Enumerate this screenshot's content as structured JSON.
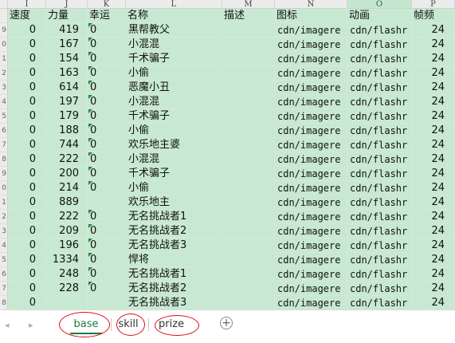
{
  "columns": [
    {
      "letter": "I",
      "header": "速度"
    },
    {
      "letter": "J",
      "header": "力量"
    },
    {
      "letter": "K",
      "header": "幸运"
    },
    {
      "letter": "L",
      "header": "名称"
    },
    {
      "letter": "M",
      "header": "描述"
    },
    {
      "letter": "N",
      "header": "图标"
    },
    {
      "letter": "O",
      "header": "动画"
    },
    {
      "letter": "P",
      "header": "帧频"
    }
  ],
  "header_rownum": "",
  "rows": [
    {
      "rn": "9",
      "speed": "0",
      "power": "419",
      "luck": "0",
      "name": "黑帮教父",
      "desc": "",
      "icon": "cdn/imagere",
      "anim": "cdn/flashr",
      "fps": "24"
    },
    {
      "rn": "0",
      "speed": "0",
      "power": "167",
      "luck": "0",
      "name": "小混混",
      "desc": "",
      "icon": "cdn/imagere",
      "anim": "cdn/flashr",
      "fps": "24"
    },
    {
      "rn": "1",
      "speed": "0",
      "power": "154",
      "luck": "0",
      "name": "千术骗子",
      "desc": "",
      "icon": "cdn/imagere",
      "anim": "cdn/flashr",
      "fps": "24"
    },
    {
      "rn": "2",
      "speed": "0",
      "power": "163",
      "luck": "0",
      "name": "小偷",
      "desc": "",
      "icon": "cdn/imagere",
      "anim": "cdn/flashr",
      "fps": "24"
    },
    {
      "rn": "3",
      "speed": "0",
      "power": "614",
      "luck": "0",
      "name": "恶魔小丑",
      "desc": "",
      "icon": "cdn/imagere",
      "anim": "cdn/flashr",
      "fps": "24"
    },
    {
      "rn": "4",
      "speed": "0",
      "power": "197",
      "luck": "0",
      "name": "小混混",
      "desc": "",
      "icon": "cdn/imagere",
      "anim": "cdn/flashr",
      "fps": "24"
    },
    {
      "rn": "5",
      "speed": "0",
      "power": "179",
      "luck": "0",
      "name": "千术骗子",
      "desc": "",
      "icon": "cdn/imagere",
      "anim": "cdn/flashr",
      "fps": "24"
    },
    {
      "rn": "6",
      "speed": "0",
      "power": "188",
      "luck": "0",
      "name": "小偷",
      "desc": "",
      "icon": "cdn/imagere",
      "anim": "cdn/flashr",
      "fps": "24"
    },
    {
      "rn": "7",
      "speed": "0",
      "power": "744",
      "luck": "0",
      "name": "欢乐地主婆",
      "desc": "",
      "icon": "cdn/imagere",
      "anim": "cdn/flashr",
      "fps": "24"
    },
    {
      "rn": "8",
      "speed": "0",
      "power": "222",
      "luck": "0",
      "name": "小混混",
      "desc": "",
      "icon": "cdn/imagere",
      "anim": "cdn/flashr",
      "fps": "24"
    },
    {
      "rn": "9",
      "speed": "0",
      "power": "200",
      "luck": "0",
      "name": "千术骗子",
      "desc": "",
      "icon": "cdn/imagere",
      "anim": "cdn/flashr",
      "fps": "24"
    },
    {
      "rn": "0",
      "speed": "0",
      "power": "214",
      "luck": "0",
      "name": "小偷",
      "desc": "",
      "icon": "cdn/imagere",
      "anim": "cdn/flashr",
      "fps": "24"
    },
    {
      "rn": "1",
      "speed": "0",
      "power": "889",
      "luck": "",
      "name": "欢乐地主",
      "desc": "",
      "icon": "cdn/imagere",
      "anim": "cdn/flashr",
      "fps": "24"
    },
    {
      "rn": "2",
      "speed": "0",
      "power": "222",
      "luck": "0",
      "name": "无名挑战者1",
      "desc": "",
      "icon": "cdn/imagere",
      "anim": "cdn/flashr",
      "fps": "24"
    },
    {
      "rn": "3",
      "speed": "0",
      "power": "209",
      "luck": "0",
      "name": "无名挑战者2",
      "desc": "",
      "icon": "cdn/imagere",
      "anim": "cdn/flashr",
      "fps": "24"
    },
    {
      "rn": "4",
      "speed": "0",
      "power": "196",
      "luck": "0",
      "name": "无名挑战者3",
      "desc": "",
      "icon": "cdn/imagere",
      "anim": "cdn/flashr",
      "fps": "24"
    },
    {
      "rn": "5",
      "speed": "0",
      "power": "1334",
      "luck": "0",
      "name": "悍将",
      "desc": "",
      "icon": "cdn/imagere",
      "anim": "cdn/flashr",
      "fps": "24"
    },
    {
      "rn": "6",
      "speed": "0",
      "power": "248",
      "luck": "0",
      "name": "无名挑战者1",
      "desc": "",
      "icon": "cdn/imagere",
      "anim": "cdn/flashr",
      "fps": "24"
    },
    {
      "rn": "7",
      "speed": "0",
      "power": "228",
      "luck": "0",
      "name": "无名挑战者2",
      "desc": "",
      "icon": "cdn/imagere",
      "anim": "cdn/flashr",
      "fps": "24"
    },
    {
      "rn": "8",
      "speed": "0",
      "power": "",
      "luck": "",
      "name": "无名挑战者3",
      "desc": "",
      "icon": "cdn/imagere",
      "anim": "cdn/flashr",
      "fps": "24"
    }
  ],
  "sheet_tabs": [
    {
      "label": "base",
      "active": true
    },
    {
      "label": "skill",
      "active": false
    },
    {
      "label": "prize",
      "active": false
    }
  ],
  "nav": {
    "prev": "◂",
    "next": "▸",
    "add": "+"
  },
  "colors": {
    "cell_bg": "#c8e9d1",
    "accent": "#1e7a3c",
    "annotation": "#e01010"
  }
}
